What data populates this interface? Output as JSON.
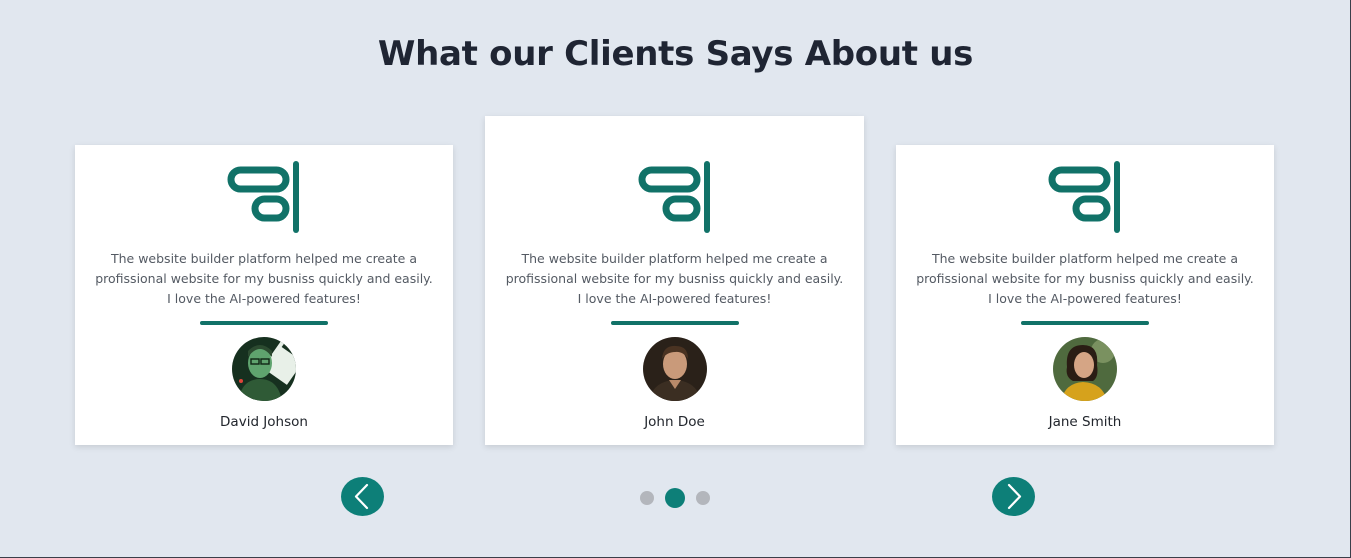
{
  "heading": "What our Clients Says About us",
  "accent_color": "#0d7f78",
  "testimonials": [
    {
      "text": "The website builder platform helped me create a profissional website for my busniss quickly and easily. I love the AI-powered features!",
      "name": "David Johson",
      "icon": "quote-icon",
      "avatar": "avatar-photo-green-tint"
    },
    {
      "text": "The website builder platform helped me create a profissional website for my busniss quickly and easily. I love the AI-powered features!",
      "name": "John Doe",
      "icon": "quote-icon",
      "avatar": "avatar-photo-man"
    },
    {
      "text": "The website builder platform helped me create a profissional website for my busniss quickly and easily. I love the AI-powered features!",
      "name": "Jane Smith",
      "icon": "quote-icon",
      "avatar": "avatar-photo-woman"
    }
  ],
  "carousel": {
    "prev_icon": "chevron-left-icon",
    "next_icon": "chevron-right-icon",
    "slide_count": 3,
    "active_slide": 2
  }
}
